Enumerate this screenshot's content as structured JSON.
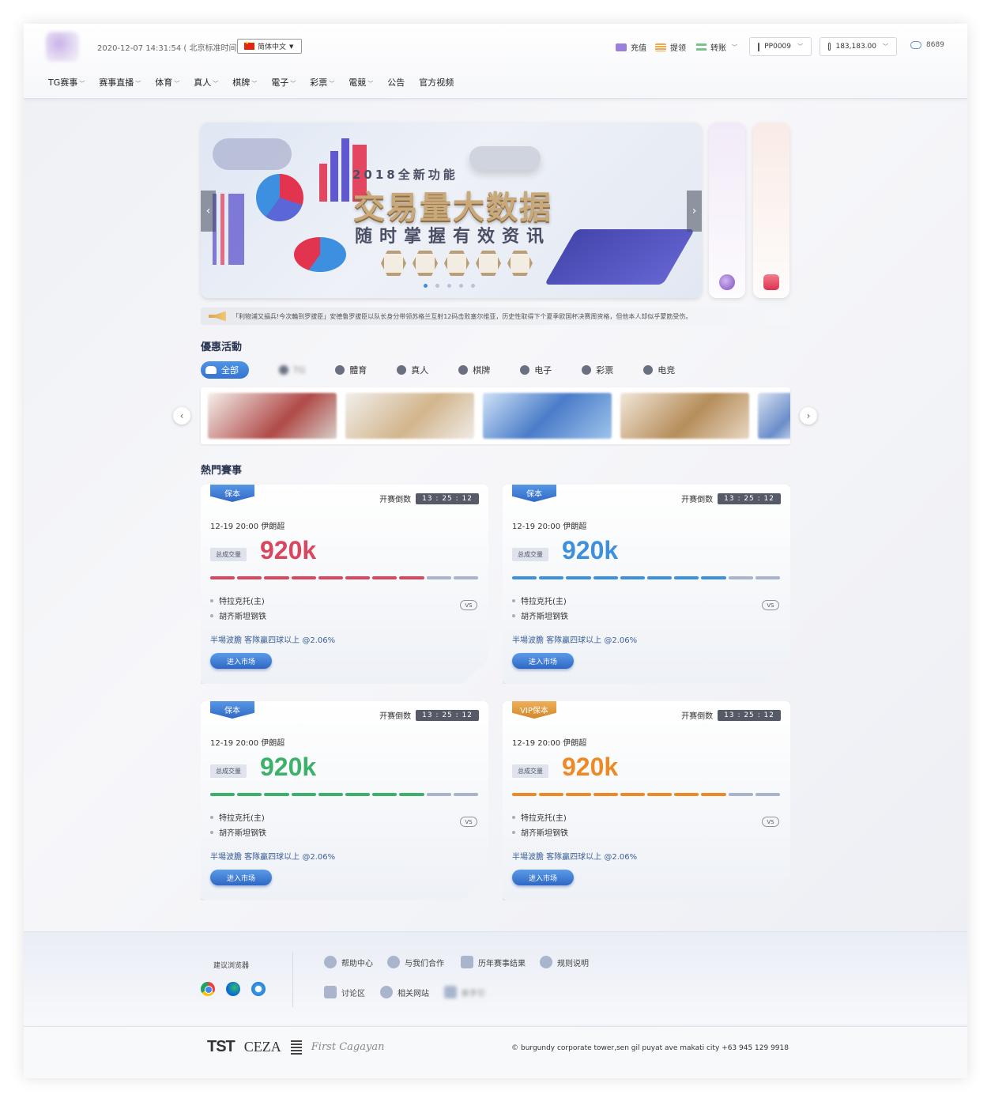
{
  "header": {
    "datetime": "2020-12-07 14:31:54 ( 北京标准时间 )",
    "language": "简体中文",
    "recharge": "充值",
    "withdraw": "提领",
    "transfer": "转账",
    "username": "PP0009",
    "balance": "183,183.00",
    "online_count": "8689"
  },
  "nav": [
    "TG赛事",
    "赛事直播",
    "体育",
    "真人",
    "棋牌",
    "電子",
    "彩票",
    "電競",
    "公告",
    "官方视频"
  ],
  "banner": {
    "subtitle": "2018全新功能",
    "title": "交易量大数据",
    "title2": "随时掌握有效资讯"
  },
  "marquee": "「利物浦又損兵!今次輪到罗拔臣」安德鲁罗拔臣以队长身分带领苏格兰互射12码击败塞尔维亚，历史性取得下个夏季欧国杯决赛周资格，但他本人却似乎蒙筋受伤。",
  "promotions": {
    "title": "優惠活動",
    "tabs": [
      "全部",
      "TG",
      "體育",
      "真人",
      "棋牌",
      "电子",
      "彩票",
      "电竞"
    ]
  },
  "hot_matches": {
    "title": "熱門賽事",
    "countdown_label": "开赛倒数",
    "vol_label": "总成交量",
    "enter_label": "进入市场",
    "vs": "VS",
    "cards": [
      {
        "tag": "保本",
        "countdown": "13 : 25 : 12",
        "time": "12-19  20:00  伊朗超",
        "volume": "920k",
        "color": "#d9475f",
        "fill": 0.8,
        "home": "特拉克托(主)",
        "away": "胡齐斯坦钢铁",
        "bet": "半場波膽 客隊贏四球以上 @2.06%"
      },
      {
        "tag": "保本",
        "countdown": "13 : 25 : 12",
        "time": "12-19  20:00  伊朗超",
        "volume": "920k",
        "color": "#3e8fdc",
        "fill": 0.8,
        "home": "特拉克托(主)",
        "away": "胡齐斯坦钢铁",
        "bet": "半場波膽 客隊贏四球以上 @2.06%"
      },
      {
        "tag": "保本",
        "countdown": "13 : 25 : 12",
        "time": "12-19  20:00  伊朗超",
        "volume": "920k",
        "color": "#3bb16a",
        "fill": 0.8,
        "home": "特拉克托(主)",
        "away": "胡齐斯坦钢铁",
        "bet": "半場波膽 客隊贏四球以上 @2.06%"
      },
      {
        "tag": "VIP保本",
        "countdown": "13 : 25 : 12",
        "time": "12-19  20:00  伊朗超",
        "volume": "920k",
        "color": "#ee8a25",
        "fill": 0.8,
        "home": "特拉克托(主)",
        "away": "胡齐斯坦钢铁",
        "bet": "半場波膽 客隊贏四球以上 @2.06%"
      }
    ]
  },
  "footer": {
    "browser_title": "建议浏览器",
    "links": [
      "帮助中心",
      "与我们合作",
      "历年赛事结果",
      "规则说明",
      "讨论区",
      "相关网站",
      "新手引"
    ],
    "logos": [
      "TST",
      "CEZA",
      "First Cagayan"
    ],
    "address": "© burgundy corporate tower,sen gil puyat ave makati city +63 945 129 9918"
  }
}
